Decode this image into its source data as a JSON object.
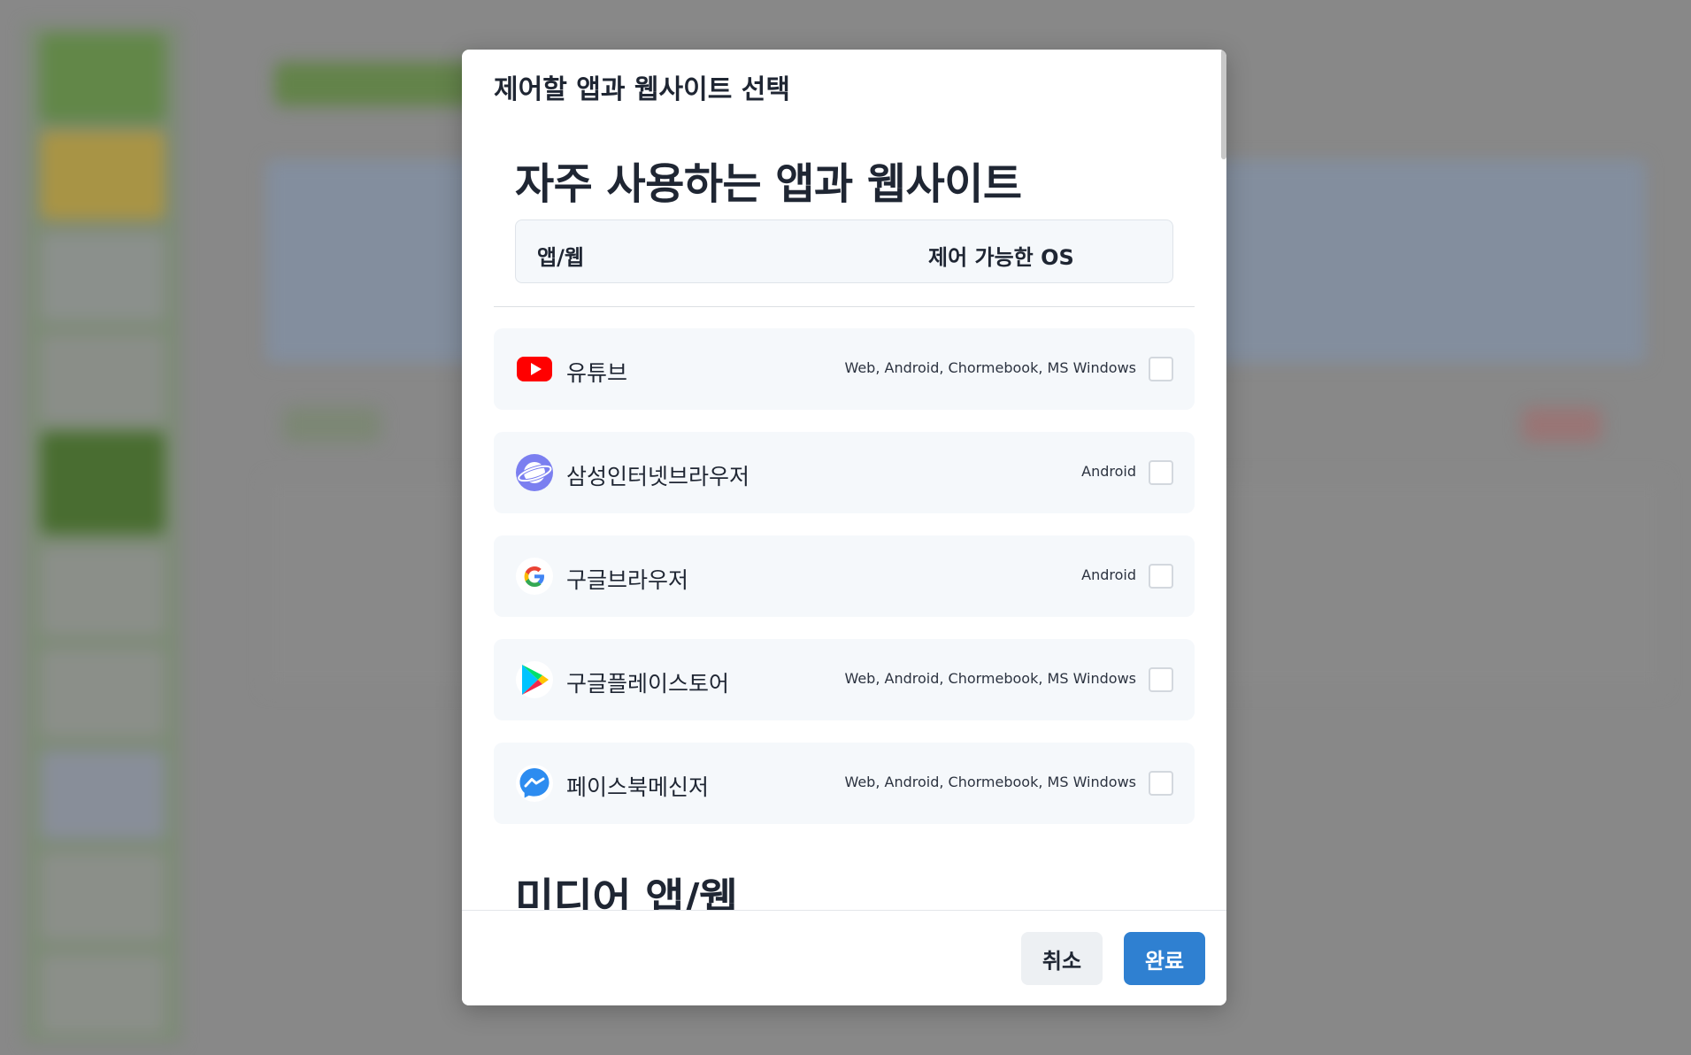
{
  "modal": {
    "title": "제어할 앱과 웹사이트 선택",
    "sections": [
      {
        "title": "자주 사용하는 앱과 웹사이트"
      },
      {
        "title": "미디어 앱/웹"
      }
    ],
    "table_header": {
      "col_app": "앱/웹",
      "col_os": "제어 가능한 OS"
    },
    "apps": [
      {
        "name": "유튜브",
        "os": "Web, Android, Chormebook, MS Windows",
        "icon": "youtube-icon"
      },
      {
        "name": "삼성인터넷브라우저",
        "os": "Android",
        "icon": "samsung-internet-icon"
      },
      {
        "name": "구글브라우저",
        "os": "Android",
        "icon": "google-icon"
      },
      {
        "name": "구글플레이스토어",
        "os": "Web, Android, Chormebook, MS Windows",
        "icon": "google-play-icon"
      },
      {
        "name": "페이스북메신저",
        "os": "Web, Android, Chormebook, MS Windows",
        "icon": "messenger-icon"
      }
    ],
    "buttons": {
      "cancel": "취소",
      "done": "완료"
    }
  },
  "colors": {
    "primary": "#2f80d1",
    "cancel_bg": "#edf0f3",
    "row_bg": "#f5f8fb",
    "youtube_red": "#ff0000",
    "samsung_purple": "#7b7ff0",
    "messenger_blue": "#2d8cf0"
  }
}
